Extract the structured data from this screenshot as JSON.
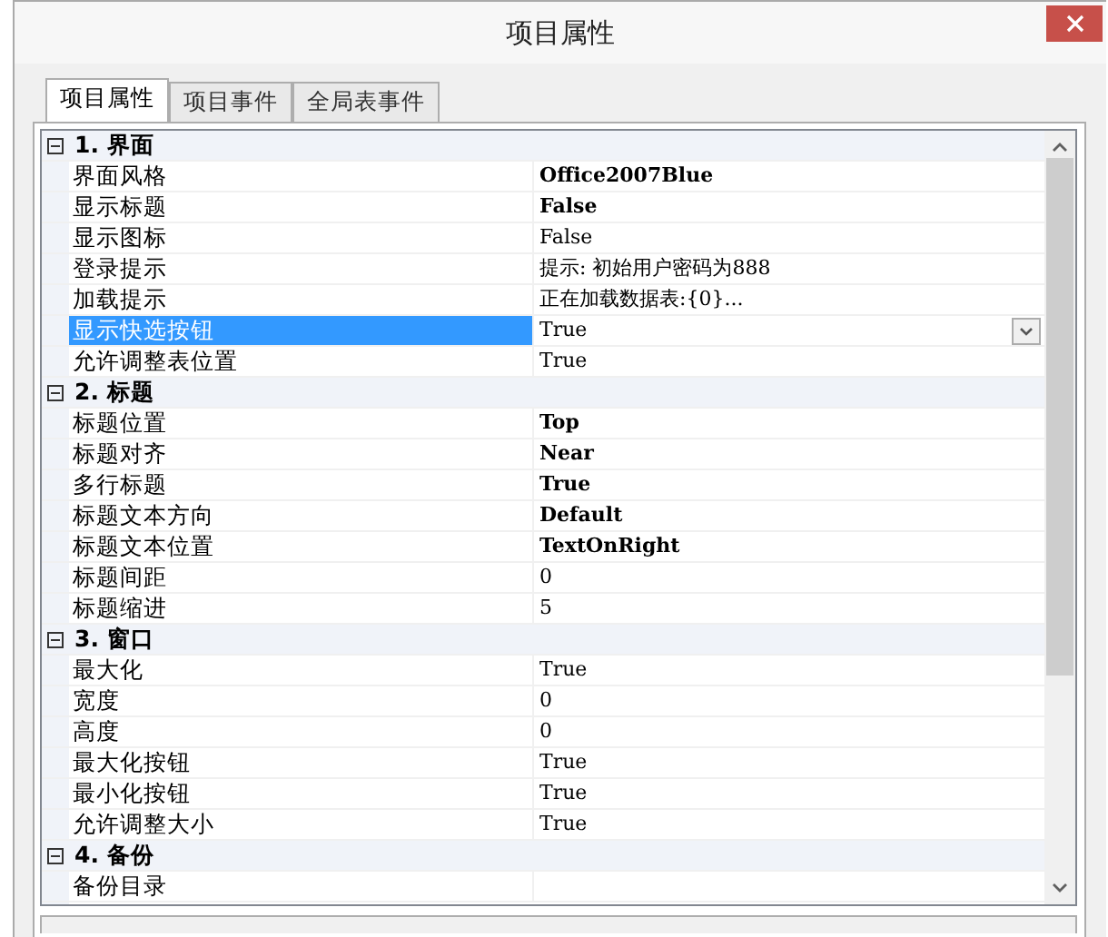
{
  "window": {
    "title": "项目属性"
  },
  "tabs": [
    {
      "label": "项目属性",
      "selected": true
    },
    {
      "label": "项目事件",
      "selected": false
    },
    {
      "label": "全局表事件",
      "selected": false
    }
  ],
  "categories": [
    {
      "label": "1. 界面",
      "expanded": true,
      "properties": [
        {
          "name": "界面风格",
          "value": "Office2007Blue",
          "modified": true,
          "selected": false
        },
        {
          "name": "显示标题",
          "value": "False",
          "modified": true,
          "selected": false
        },
        {
          "name": "显示图标",
          "value": "False",
          "modified": false,
          "selected": false
        },
        {
          "name": "登录提示",
          "value": "提示: 初始用户密码为888",
          "modified": false,
          "selected": false
        },
        {
          "name": "加载提示",
          "value": "正在加载数据表:{0}...",
          "modified": false,
          "selected": false
        },
        {
          "name": "显示快选按钮",
          "value": "True",
          "modified": false,
          "selected": true
        },
        {
          "name": "允许调整表位置",
          "value": "True",
          "modified": false,
          "selected": false
        }
      ]
    },
    {
      "label": "2. 标题",
      "expanded": true,
      "properties": [
        {
          "name": "标题位置",
          "value": "Top",
          "modified": true,
          "selected": false
        },
        {
          "name": "标题对齐",
          "value": "Near",
          "modified": true,
          "selected": false
        },
        {
          "name": "多行标题",
          "value": "True",
          "modified": true,
          "selected": false
        },
        {
          "name": "标题文本方向",
          "value": "Default",
          "modified": true,
          "selected": false
        },
        {
          "name": "标题文本位置",
          "value": "TextOnRight",
          "modified": true,
          "selected": false
        },
        {
          "name": "标题间距",
          "value": "0",
          "modified": false,
          "selected": false
        },
        {
          "name": "标题缩进",
          "value": "5",
          "modified": false,
          "selected": false
        }
      ]
    },
    {
      "label": "3. 窗口",
      "expanded": true,
      "properties": [
        {
          "name": "最大化",
          "value": "True",
          "modified": false,
          "selected": false
        },
        {
          "name": "宽度",
          "value": "0",
          "modified": false,
          "selected": false
        },
        {
          "name": "高度",
          "value": "0",
          "modified": false,
          "selected": false
        },
        {
          "name": "最大化按钮",
          "value": "True",
          "modified": false,
          "selected": false
        },
        {
          "name": "最小化按钮",
          "value": "True",
          "modified": false,
          "selected": false
        },
        {
          "name": "允许调整大小",
          "value": "True",
          "modified": false,
          "selected": false
        }
      ]
    },
    {
      "label": "4. 备份",
      "expanded": true,
      "properties": [
        {
          "name": "备份目录",
          "selected": false
        }
      ]
    }
  ]
}
